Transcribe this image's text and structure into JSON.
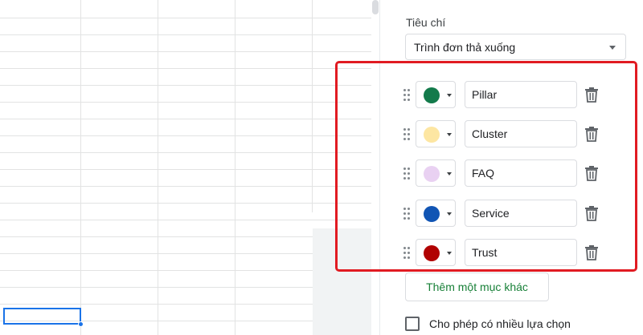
{
  "panel": {
    "criteria_label": "Tiêu chí",
    "criteria_value": "Trình đơn thả xuống",
    "items": [
      {
        "label": "Pillar",
        "color": "#137a4b"
      },
      {
        "label": "Cluster",
        "color": "#fde6a2"
      },
      {
        "label": "FAQ",
        "color": "#e9d1f2"
      },
      {
        "label": "Service",
        "color": "#1155b4"
      },
      {
        "label": "Trust",
        "color": "#b10202"
      }
    ],
    "add_item_label": "Thêm một mục khác",
    "allow_multiple_label": "Cho phép có nhiều lựa chọn"
  },
  "colors": {
    "highlight": "#e11b22",
    "selection": "#1a73e8",
    "add_button_text": "#188038"
  }
}
